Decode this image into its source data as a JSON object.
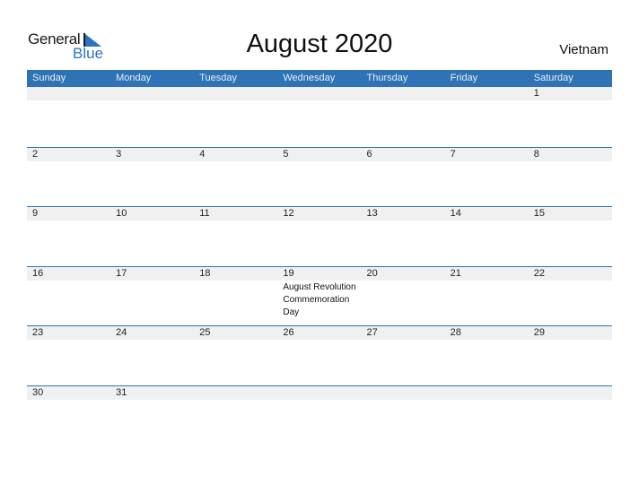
{
  "logo": {
    "line1": "General",
    "line2": "Blue"
  },
  "title": "August 2020",
  "country": "Vietnam",
  "colors": {
    "header": "#2e73b5",
    "band": "#f0f0f0",
    "brand_blue": "#2a73c0"
  },
  "weekdays": [
    "Sunday",
    "Monday",
    "Tuesday",
    "Wednesday",
    "Thursday",
    "Friday",
    "Saturday"
  ],
  "weeks": [
    [
      {
        "d": ""
      },
      {
        "d": ""
      },
      {
        "d": ""
      },
      {
        "d": ""
      },
      {
        "d": ""
      },
      {
        "d": ""
      },
      {
        "d": "1"
      }
    ],
    [
      {
        "d": "2"
      },
      {
        "d": "3"
      },
      {
        "d": "4"
      },
      {
        "d": "5"
      },
      {
        "d": "6"
      },
      {
        "d": "7"
      },
      {
        "d": "8"
      }
    ],
    [
      {
        "d": "9"
      },
      {
        "d": "10"
      },
      {
        "d": "11"
      },
      {
        "d": "12"
      },
      {
        "d": "13"
      },
      {
        "d": "14"
      },
      {
        "d": "15"
      }
    ],
    [
      {
        "d": "16"
      },
      {
        "d": "17"
      },
      {
        "d": "18"
      },
      {
        "d": "19",
        "event": "August Revolution Commemoration Day"
      },
      {
        "d": "20"
      },
      {
        "d": "21"
      },
      {
        "d": "22"
      }
    ],
    [
      {
        "d": "23"
      },
      {
        "d": "24"
      },
      {
        "d": "25"
      },
      {
        "d": "26"
      },
      {
        "d": "27"
      },
      {
        "d": "28"
      },
      {
        "d": "29"
      }
    ],
    [
      {
        "d": "30"
      },
      {
        "d": "31"
      },
      {
        "d": ""
      },
      {
        "d": ""
      },
      {
        "d": ""
      },
      {
        "d": ""
      },
      {
        "d": ""
      }
    ]
  ]
}
